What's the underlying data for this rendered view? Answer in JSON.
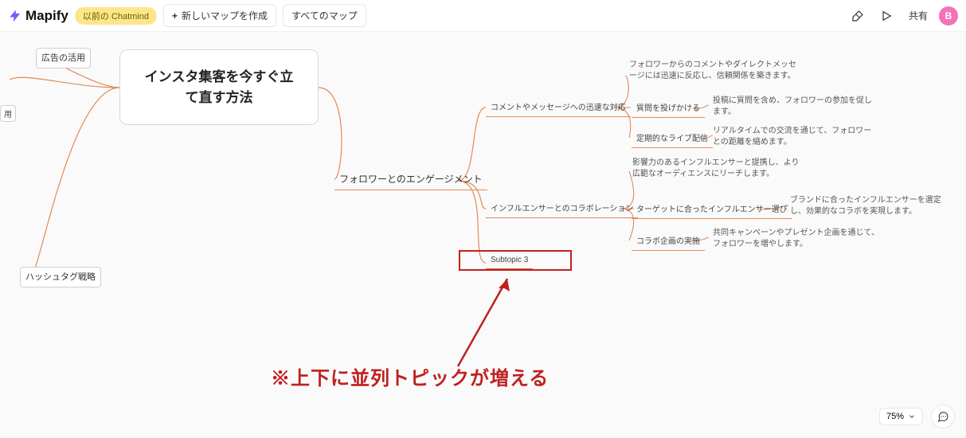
{
  "brand": "Mapify",
  "toolbar": {
    "prev_label": "以前の Chatmind",
    "new_map_label": "新しいマップを作成",
    "all_maps_label": "すべてのマップ",
    "share_label": "共有"
  },
  "avatar_letter": "B",
  "central_title": "インスタ集客を今すぐ立て直す方法",
  "left_nodes": {
    "ads": "広告の活用",
    "hashtag": "ハッシュタグ戦略",
    "stub": "用"
  },
  "branch_label": "フォロワーとのエンゲージメント",
  "sub": {
    "comments": "コメントやメッセージへの迅速な対応",
    "collab": "インフルエンサーとのコラボレーション",
    "subtopic3": "Subtopic 3"
  },
  "leaf": {
    "q": "質問を投げかける",
    "live": "定期的なライブ配信",
    "target": "ターゲットに合ったインフルエンサー選び",
    "plan": "コラボ企画の実施"
  },
  "desc": {
    "d1": "フォロワーからのコメントやダイレクトメッセージには迅速に反応し、信頼関係を築きます。",
    "d2": "投稿に質問を含め、フォロワーの参加を促します。",
    "d3": "リアルタイムでの交流を通じて、フォロワーとの距離を縮めます。",
    "d4": "影響力のあるインフルエンサーと提携し、より広範なオーディエンスにリーチします。",
    "d5": "ブランドに合ったインフルエンサーを選定し、効果的なコラボを実現します。",
    "d6": "共同キャンペーンやプレゼント企画を通じて、フォロワーを増やします。"
  },
  "annotation": "※上下に並列トピックが増える",
  "zoom_label": "75%"
}
